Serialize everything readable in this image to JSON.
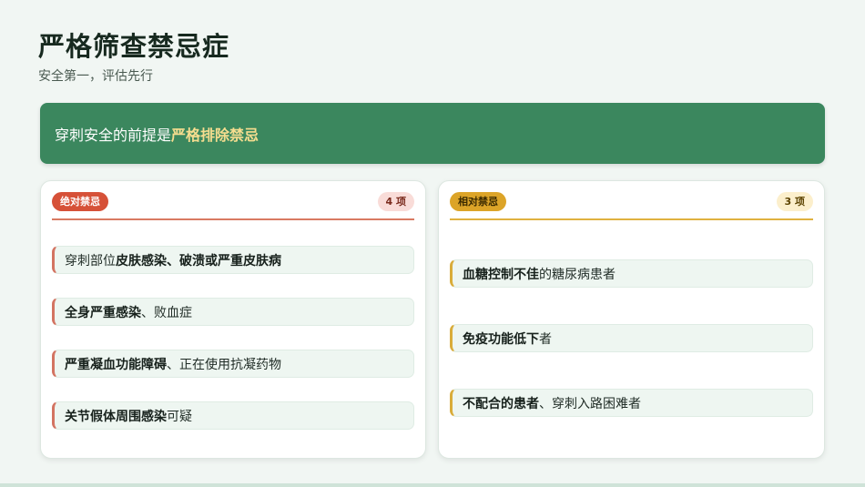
{
  "header": {
    "title": "严格筛查禁忌症",
    "subtitle": "安全第一，评估先行"
  },
  "banner": {
    "text_plain": "穿刺安全的前提是",
    "text_highlight": "严格排除禁忌"
  },
  "cards": [
    {
      "tag": "绝对禁忌",
      "count": "4 项",
      "items": [
        {
          "pre": "穿刺部位",
          "bold": "皮肤感染、破溃或严重皮肤病",
          "post": ""
        },
        {
          "pre": "",
          "bold": "全身严重感染",
          "post": "、败血症"
        },
        {
          "pre": "",
          "bold": "严重凝血功能障碍",
          "post": "、正在使用抗凝药物"
        },
        {
          "pre": "",
          "bold": "关节假体周围感染",
          "post": "可疑"
        }
      ]
    },
    {
      "tag": "相对禁忌",
      "count": "3 项",
      "items": [
        {
          "pre": "",
          "bold": "血糖控制不佳",
          "post": "的糖尿病患者"
        },
        {
          "pre": "",
          "bold": "免疫功能低下",
          "post": "者"
        },
        {
          "pre": "",
          "bold": "不配合的患者",
          "post": "、穿刺入路困难者"
        }
      ]
    }
  ],
  "colors": {
    "banner": "#3b875e",
    "highlight": "#f6dd8f",
    "absolute": "#d65138",
    "relative": "#dca428"
  }
}
